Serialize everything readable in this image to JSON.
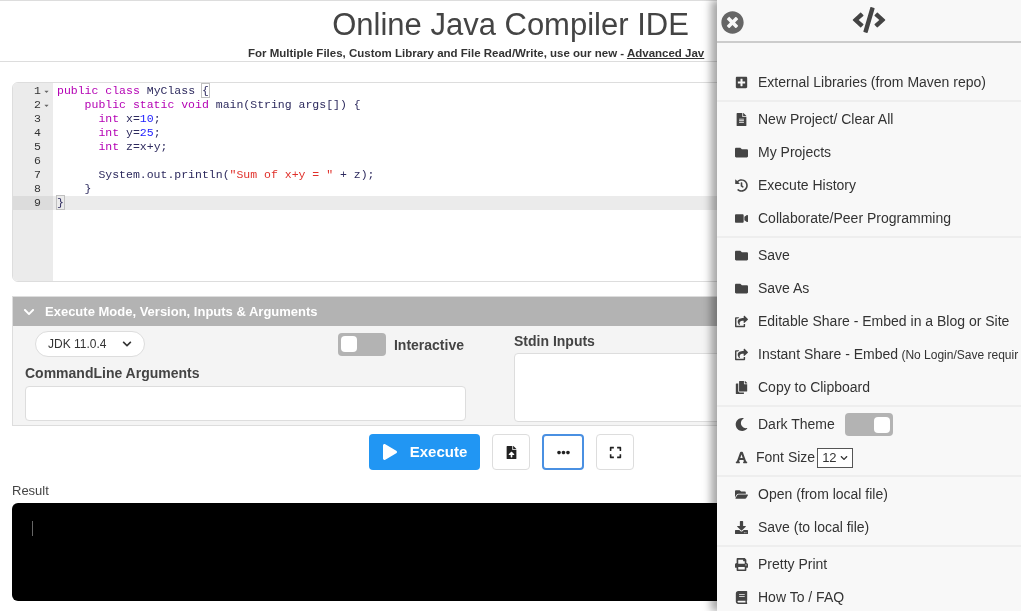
{
  "page": {
    "title": "Online Java Compiler IDE",
    "subtitle": "For Multiple Files, Custom Library and File Read/Write, use our new - ",
    "subtitle_link": "Advanced Jav"
  },
  "editor": {
    "lines": [
      {
        "number": "1",
        "foldable": true,
        "active": false,
        "tokens": [
          {
            "kind": "keyword",
            "text": "public class"
          },
          {
            "kind": "plain",
            "text": " MyClass "
          },
          {
            "kind": "bracket",
            "text": "{"
          }
        ]
      },
      {
        "number": "2",
        "foldable": true,
        "active": false,
        "tokens": [
          {
            "kind": "keyword",
            "text": "    public static void"
          },
          {
            "kind": "plain",
            "text": " main(String args[]) {"
          }
        ]
      },
      {
        "number": "3",
        "foldable": false,
        "active": false,
        "tokens": [
          {
            "kind": "keyword",
            "text": "      int"
          },
          {
            "kind": "plain",
            "text": " x="
          },
          {
            "kind": "number",
            "text": "10"
          },
          {
            "kind": "plain",
            "text": ";"
          }
        ]
      },
      {
        "number": "4",
        "foldable": false,
        "active": false,
        "tokens": [
          {
            "kind": "keyword",
            "text": "      int"
          },
          {
            "kind": "plain",
            "text": " y="
          },
          {
            "kind": "number",
            "text": "25"
          },
          {
            "kind": "plain",
            "text": ";"
          }
        ]
      },
      {
        "number": "5",
        "foldable": false,
        "active": false,
        "tokens": [
          {
            "kind": "keyword",
            "text": "      int"
          },
          {
            "kind": "plain",
            "text": " z=x+y;"
          }
        ]
      },
      {
        "number": "6",
        "foldable": false,
        "active": false
      },
      {
        "number": "7",
        "foldable": false,
        "active": false,
        "tokens": [
          {
            "kind": "plain",
            "text": "      System.out.println("
          },
          {
            "kind": "string",
            "text": "\"Sum of x+y = \""
          },
          {
            "kind": "plain",
            "text": " + z);"
          }
        ]
      },
      {
        "number": "8",
        "foldable": false,
        "active": false,
        "tokens": [
          {
            "kind": "plain",
            "text": "    }"
          }
        ]
      },
      {
        "number": "9",
        "foldable": false,
        "active": true,
        "tokens": [
          {
            "kind": "bracket",
            "text": "}"
          }
        ]
      }
    ]
  },
  "execute_options": {
    "title": "Execute Mode, Version, Inputs & Arguments",
    "expanded": true,
    "version": "JDK 11.0.4",
    "interactive": {
      "label": "Interactive",
      "on": false
    },
    "arguments_label": "CommandLine Arguments",
    "stdin_label": "Stdin Inputs"
  },
  "actions": {
    "execute": "Execute",
    "tool_buttons": [
      {
        "selected": false
      },
      {
        "selected": true
      },
      {
        "selected": false
      }
    ]
  },
  "result": {
    "label": "Result"
  },
  "menu": {
    "groups": [
      [
        {
          "kind": "link",
          "label": "External Libraries (from Maven repo)"
        }
      ],
      [
        {
          "kind": "link",
          "label": "New Project/ Clear All"
        },
        {
          "kind": "link",
          "label": "My Projects"
        },
        {
          "kind": "link",
          "label": "Execute History"
        },
        {
          "kind": "link",
          "label": "Collaborate/Peer Programming"
        }
      ],
      [
        {
          "kind": "link",
          "label": "Save"
        },
        {
          "kind": "link",
          "label": "Save As"
        },
        {
          "kind": "link",
          "label": "Editable Share - Embed in a Blog or Site"
        },
        {
          "kind": "link",
          "label": "Instant Share - Embed",
          "note": "(No Login/Save requir"
        },
        {
          "kind": "link",
          "label": "Copy to Clipboard"
        }
      ],
      [
        {
          "kind": "toggle",
          "label": "Dark Theme",
          "on": true
        },
        {
          "kind": "select",
          "label": "Font Size",
          "value": "12"
        }
      ],
      [
        {
          "kind": "link",
          "label": "Open (from local file)"
        },
        {
          "kind": "link",
          "label": "Save (to local file)"
        }
      ],
      [
        {
          "kind": "link",
          "label": "Pretty Print"
        },
        {
          "kind": "link",
          "label": "How To / FAQ"
        }
      ]
    ]
  }
}
